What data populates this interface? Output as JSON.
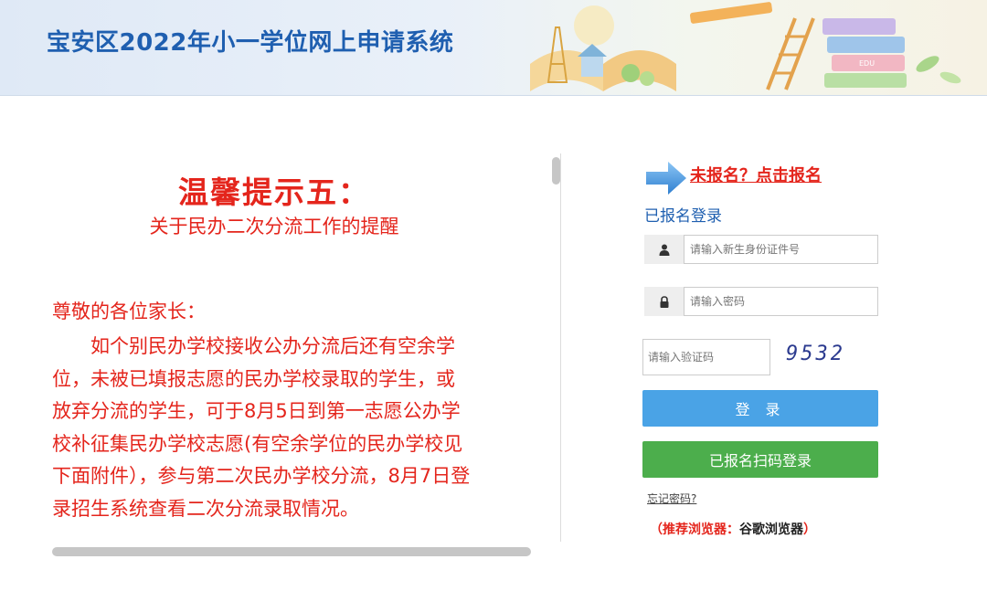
{
  "header": {
    "title": "宝安区2022年小一学位网上申请系统",
    "illustration_badge": "EDU"
  },
  "notice": {
    "title": "温馨提示五：",
    "subtitle": "关于民办二次分流工作的提醒",
    "greeting": "尊敬的各位家长：",
    "body": "如个别民办学校接收公办分流后还有空余学位，未被已填报志愿的民办学校录取的学生，或放弃分流的学生，可于8月5日到第一志愿公办学校补征集民办学校志愿(有空余学位的民办学校见下面附件），参与第二次民办学校分流，8月7日登录招生系统查看二次分流录取情况。"
  },
  "login": {
    "register_link": "未报名？点击报名",
    "heading": "已报名登录",
    "id_placeholder": "请输入新生身份证件号",
    "password_placeholder": "请输入密码",
    "captcha_placeholder": "请输入验证码",
    "captcha_code": "9532",
    "login_button": "登 录",
    "scan_button": "已报名扫码登录",
    "forgot_password": "忘记密码?",
    "browser_tip_open": "（推荐浏览器：",
    "browser_tip_name": "谷歌浏览器",
    "browser_tip_close": "）"
  },
  "colors": {
    "title_blue": "#1f5fb0",
    "notice_red": "#e4251c",
    "login_button": "#4aa3e6",
    "scan_button": "#4cae4c"
  },
  "icons": [
    "user-icon",
    "lock-icon",
    "arrow-right-icon"
  ]
}
